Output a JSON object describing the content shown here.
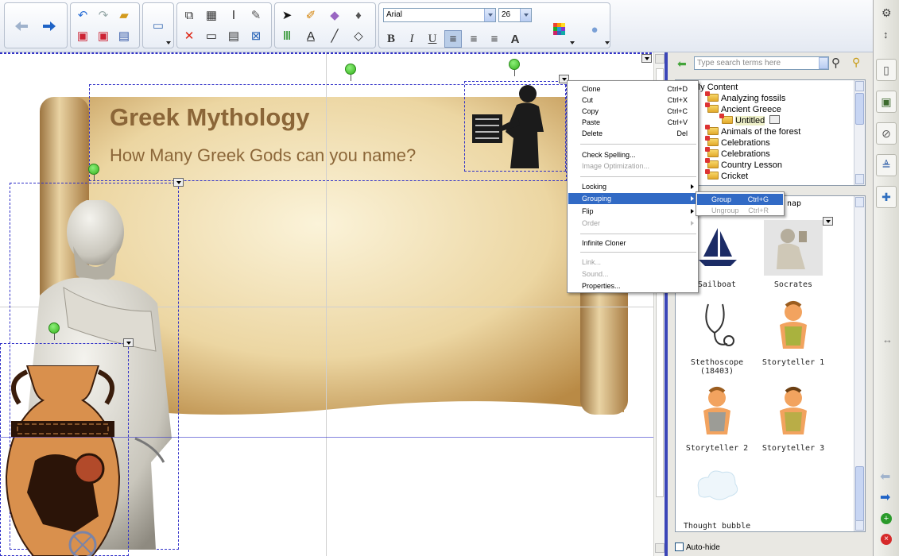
{
  "toolbar": {
    "font_name": "Arial",
    "font_size": "26"
  },
  "slide": {
    "title": "Greek Mythology",
    "subtitle": "How Many Greek Gods can you name?"
  },
  "context_menu": {
    "items": [
      {
        "label": "Clone",
        "shortcut": "Ctrl+D"
      },
      {
        "label": "Cut",
        "shortcut": "Ctrl+X"
      },
      {
        "label": "Copy",
        "shortcut": "Ctrl+C"
      },
      {
        "label": "Paste",
        "shortcut": "Ctrl+V"
      },
      {
        "label": "Delete",
        "shortcut": "Del"
      },
      {
        "label": "Check Spelling..."
      },
      {
        "label": "Image Optimization..."
      },
      {
        "label": "Locking"
      },
      {
        "label": "Grouping"
      },
      {
        "label": "Flip"
      },
      {
        "label": "Order"
      },
      {
        "label": "Infinite Cloner"
      },
      {
        "label": "Link..."
      },
      {
        "label": "Sound..."
      },
      {
        "label": "Properties..."
      }
    ]
  },
  "submenu": {
    "items": [
      {
        "label": "Group",
        "shortcut": "Ctrl+G"
      },
      {
        "label": "Ungroup",
        "shortcut": "Ctrl+R"
      }
    ]
  },
  "side_panel": {
    "search_placeholder": "Type search terms here",
    "tree": [
      {
        "label": "My Content"
      },
      {
        "label": "Analyzing fossils"
      },
      {
        "label": "Ancient Greece"
      },
      {
        "label": "Untitled"
      },
      {
        "label": "Animals of the forest"
      },
      {
        "label": "Celebrations"
      },
      {
        "label": "Celebrations"
      },
      {
        "label": "Country Lesson"
      },
      {
        "label": "Cricket"
      }
    ],
    "gallery_header": "nap",
    "gallery": [
      {
        "label": "Sailboat"
      },
      {
        "label": "Socrates"
      },
      {
        "label": "Stethoscope (18403)"
      },
      {
        "label": "Storyteller 1"
      },
      {
        "label": "Storyteller 2"
      },
      {
        "label": "Storyteller 3"
      },
      {
        "label": "Thought bubble"
      }
    ],
    "autohide_label": "Auto-hide"
  },
  "colors": {
    "accent": "#316ac5",
    "title_text": "#8b6638",
    "selection_border": "#3030c8",
    "handle": "#35b21d"
  }
}
